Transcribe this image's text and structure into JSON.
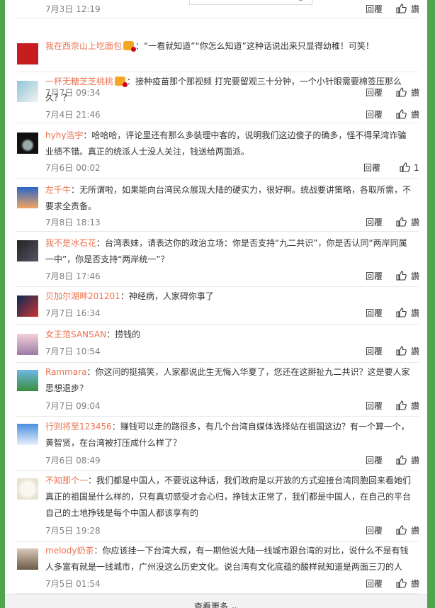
{
  "ui": {
    "reply_label": "回覆",
    "more_label": "查看更多"
  },
  "comments": [
    {
      "user": "",
      "badge": false,
      "text": "",
      "time": "7月3日 12:19",
      "likes": ""
    },
    {
      "user": "我在西奈山上吃面包",
      "badge": true,
      "text": "：“一看就知道”“你怎么知道”这种话说出来只显得幼稚！可笑！",
      "time": "7月7日 09:34",
      "likes": ""
    },
    {
      "user": "一杯无糖芝芝桃桃",
      "badge": true,
      "text": "：接种疫苗那个那视频 打完要留观三十分钟，一个小针眼需要棉签压那么久？？",
      "time": "7月4日 21:46",
      "likes": ""
    },
    {
      "user": "hyhy浩宇",
      "badge": false,
      "text": "：哈哈哈，评论里还有那么多装理中客的，说明我们这边傻子的确多，怪不得呆湾诈骗业绩不错。真正的统派人士没人关注，钱送给两面派。",
      "time": "7月6日 00:02",
      "likes": "1"
    },
    {
      "user": "左千牛",
      "badge": false,
      "text": "：无所谓啦，如果能向台湾民众展现大陆的硬实力，很好啊。统战要讲策略，各取所需，不要求全责备。",
      "time": "7月8日 18:13",
      "likes": ""
    },
    {
      "user": "我不是冰石花",
      "badge": false,
      "text": "：台湾表妹，请表达你的政治立场：你是否支持“九二共识”，你是否认同“两岸同属一中”，你是否支持“两岸统一”？",
      "time": "7月8日 17:46",
      "likes": ""
    },
    {
      "user": "贝加尔湖畔201201",
      "badge": false,
      "text": "：神经病，人家碍你事了",
      "time": "7月7日 16:34",
      "likes": ""
    },
    {
      "user": "女王范SANSAN",
      "badge": false,
      "text": "：捞钱的",
      "time": "7月7日 10:54",
      "likes": ""
    },
    {
      "user": "Rammara",
      "badge": false,
      "text": "：你这问的挺搞笑，人家都说此生无悔入华夏了，您还在这掰扯九二共识？这是要人家思想退步？",
      "time": "7月7日 09:04",
      "likes": ""
    },
    {
      "user": "行则将至123456",
      "badge": false,
      "text": "：赚钱可以走的路很多，有几个台湾自媒体选择站在祖国这边？有一个算一个，黄智贤，在台湾被打压成什么样了？",
      "time": "7月6日 08:49",
      "likes": ""
    },
    {
      "user": "不知那个一",
      "badge": false,
      "text": "：我们都是中国人，不要说这种话，我们政府是以开放的方式迎接台湾同胞回来看她们真正的祖国是什么样的，只有真切感受才会心归，挣钱太正常了，我们都是中国人，在自己的平台自己的土地挣钱是每个中国人都该享有的",
      "time": "7月5日 19:28",
      "likes": ""
    },
    {
      "user": "melody奶茶",
      "badge": false,
      "text": "：你应该挂一下台湾大叔，有一期他说大陆一线城市跟台湾的对比，说什么不是有钱人多富有就是一线城市，广州没这么历史文化。说台湾有文化底蕴的酸样就知道是两面三刀的人",
      "time": "7月5日 01:54",
      "likes": ""
    }
  ],
  "colors": {
    "frame": "#52a44c",
    "username": "#eb7350",
    "text": "#333333",
    "meta": "#808080"
  }
}
